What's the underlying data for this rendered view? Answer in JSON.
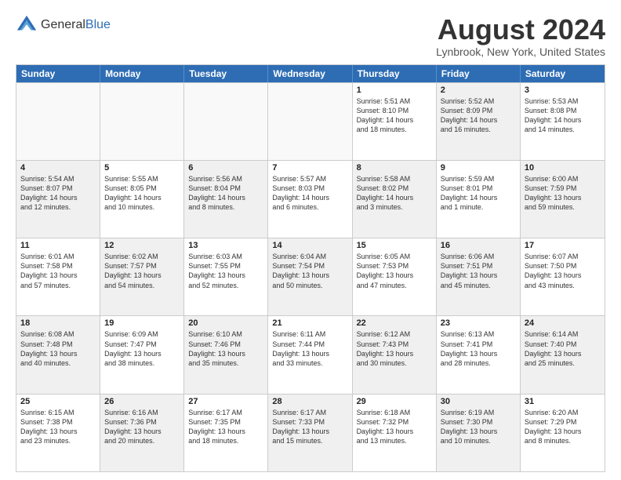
{
  "header": {
    "logo_general": "General",
    "logo_blue": "Blue",
    "month_title": "August 2024",
    "location": "Lynbrook, New York, United States"
  },
  "days_of_week": [
    "Sunday",
    "Monday",
    "Tuesday",
    "Wednesday",
    "Thursday",
    "Friday",
    "Saturday"
  ],
  "weeks": [
    [
      {
        "day": "",
        "info": "",
        "shaded": false,
        "empty": true
      },
      {
        "day": "",
        "info": "",
        "shaded": false,
        "empty": true
      },
      {
        "day": "",
        "info": "",
        "shaded": false,
        "empty": true
      },
      {
        "day": "",
        "info": "",
        "shaded": false,
        "empty": true
      },
      {
        "day": "1",
        "info": "Sunrise: 5:51 AM\nSunset: 8:10 PM\nDaylight: 14 hours\nand 18 minutes.",
        "shaded": false,
        "empty": false
      },
      {
        "day": "2",
        "info": "Sunrise: 5:52 AM\nSunset: 8:09 PM\nDaylight: 14 hours\nand 16 minutes.",
        "shaded": true,
        "empty": false
      },
      {
        "day": "3",
        "info": "Sunrise: 5:53 AM\nSunset: 8:08 PM\nDaylight: 14 hours\nand 14 minutes.",
        "shaded": false,
        "empty": false
      }
    ],
    [
      {
        "day": "4",
        "info": "Sunrise: 5:54 AM\nSunset: 8:07 PM\nDaylight: 14 hours\nand 12 minutes.",
        "shaded": true,
        "empty": false
      },
      {
        "day": "5",
        "info": "Sunrise: 5:55 AM\nSunset: 8:05 PM\nDaylight: 14 hours\nand 10 minutes.",
        "shaded": false,
        "empty": false
      },
      {
        "day": "6",
        "info": "Sunrise: 5:56 AM\nSunset: 8:04 PM\nDaylight: 14 hours\nand 8 minutes.",
        "shaded": true,
        "empty": false
      },
      {
        "day": "7",
        "info": "Sunrise: 5:57 AM\nSunset: 8:03 PM\nDaylight: 14 hours\nand 6 minutes.",
        "shaded": false,
        "empty": false
      },
      {
        "day": "8",
        "info": "Sunrise: 5:58 AM\nSunset: 8:02 PM\nDaylight: 14 hours\nand 3 minutes.",
        "shaded": true,
        "empty": false
      },
      {
        "day": "9",
        "info": "Sunrise: 5:59 AM\nSunset: 8:01 PM\nDaylight: 14 hours\nand 1 minute.",
        "shaded": false,
        "empty": false
      },
      {
        "day": "10",
        "info": "Sunrise: 6:00 AM\nSunset: 7:59 PM\nDaylight: 13 hours\nand 59 minutes.",
        "shaded": true,
        "empty": false
      }
    ],
    [
      {
        "day": "11",
        "info": "Sunrise: 6:01 AM\nSunset: 7:58 PM\nDaylight: 13 hours\nand 57 minutes.",
        "shaded": false,
        "empty": false
      },
      {
        "day": "12",
        "info": "Sunrise: 6:02 AM\nSunset: 7:57 PM\nDaylight: 13 hours\nand 54 minutes.",
        "shaded": true,
        "empty": false
      },
      {
        "day": "13",
        "info": "Sunrise: 6:03 AM\nSunset: 7:55 PM\nDaylight: 13 hours\nand 52 minutes.",
        "shaded": false,
        "empty": false
      },
      {
        "day": "14",
        "info": "Sunrise: 6:04 AM\nSunset: 7:54 PM\nDaylight: 13 hours\nand 50 minutes.",
        "shaded": true,
        "empty": false
      },
      {
        "day": "15",
        "info": "Sunrise: 6:05 AM\nSunset: 7:53 PM\nDaylight: 13 hours\nand 47 minutes.",
        "shaded": false,
        "empty": false
      },
      {
        "day": "16",
        "info": "Sunrise: 6:06 AM\nSunset: 7:51 PM\nDaylight: 13 hours\nand 45 minutes.",
        "shaded": true,
        "empty": false
      },
      {
        "day": "17",
        "info": "Sunrise: 6:07 AM\nSunset: 7:50 PM\nDaylight: 13 hours\nand 43 minutes.",
        "shaded": false,
        "empty": false
      }
    ],
    [
      {
        "day": "18",
        "info": "Sunrise: 6:08 AM\nSunset: 7:48 PM\nDaylight: 13 hours\nand 40 minutes.",
        "shaded": true,
        "empty": false
      },
      {
        "day": "19",
        "info": "Sunrise: 6:09 AM\nSunset: 7:47 PM\nDaylight: 13 hours\nand 38 minutes.",
        "shaded": false,
        "empty": false
      },
      {
        "day": "20",
        "info": "Sunrise: 6:10 AM\nSunset: 7:46 PM\nDaylight: 13 hours\nand 35 minutes.",
        "shaded": true,
        "empty": false
      },
      {
        "day": "21",
        "info": "Sunrise: 6:11 AM\nSunset: 7:44 PM\nDaylight: 13 hours\nand 33 minutes.",
        "shaded": false,
        "empty": false
      },
      {
        "day": "22",
        "info": "Sunrise: 6:12 AM\nSunset: 7:43 PM\nDaylight: 13 hours\nand 30 minutes.",
        "shaded": true,
        "empty": false
      },
      {
        "day": "23",
        "info": "Sunrise: 6:13 AM\nSunset: 7:41 PM\nDaylight: 13 hours\nand 28 minutes.",
        "shaded": false,
        "empty": false
      },
      {
        "day": "24",
        "info": "Sunrise: 6:14 AM\nSunset: 7:40 PM\nDaylight: 13 hours\nand 25 minutes.",
        "shaded": true,
        "empty": false
      }
    ],
    [
      {
        "day": "25",
        "info": "Sunrise: 6:15 AM\nSunset: 7:38 PM\nDaylight: 13 hours\nand 23 minutes.",
        "shaded": false,
        "empty": false
      },
      {
        "day": "26",
        "info": "Sunrise: 6:16 AM\nSunset: 7:36 PM\nDaylight: 13 hours\nand 20 minutes.",
        "shaded": true,
        "empty": false
      },
      {
        "day": "27",
        "info": "Sunrise: 6:17 AM\nSunset: 7:35 PM\nDaylight: 13 hours\nand 18 minutes.",
        "shaded": false,
        "empty": false
      },
      {
        "day": "28",
        "info": "Sunrise: 6:17 AM\nSunset: 7:33 PM\nDaylight: 13 hours\nand 15 minutes.",
        "shaded": true,
        "empty": false
      },
      {
        "day": "29",
        "info": "Sunrise: 6:18 AM\nSunset: 7:32 PM\nDaylight: 13 hours\nand 13 minutes.",
        "shaded": false,
        "empty": false
      },
      {
        "day": "30",
        "info": "Sunrise: 6:19 AM\nSunset: 7:30 PM\nDaylight: 13 hours\nand 10 minutes.",
        "shaded": true,
        "empty": false
      },
      {
        "day": "31",
        "info": "Sunrise: 6:20 AM\nSunset: 7:29 PM\nDaylight: 13 hours\nand 8 minutes.",
        "shaded": false,
        "empty": false
      }
    ]
  ]
}
